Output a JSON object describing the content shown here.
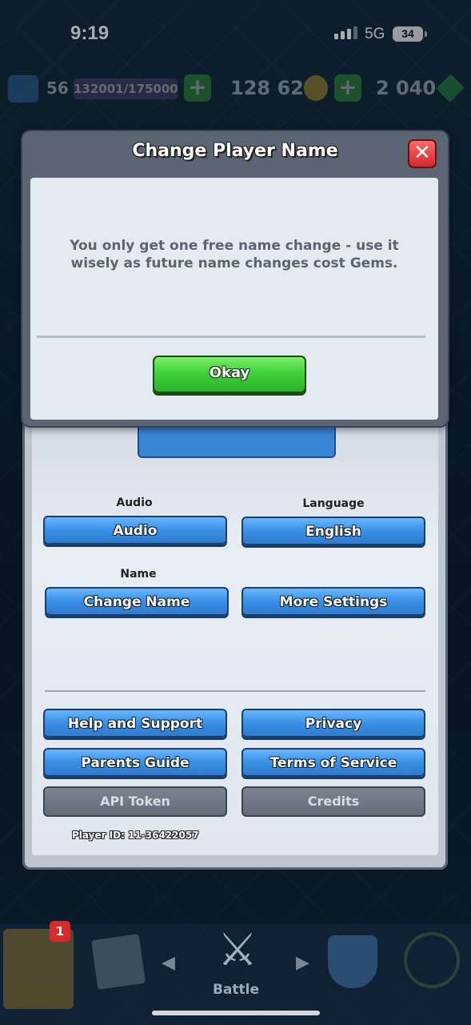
{
  "status_bar": {
    "time": "9:19",
    "network": "5G",
    "battery": "34"
  },
  "resources": {
    "level": "56",
    "xp": "132001/175000",
    "gold": "128 621",
    "gems": "2 040",
    "plus_label": "+"
  },
  "modal": {
    "title": "Change Player Name",
    "close_label": "✕",
    "message": "You only get one free name change - use it wisely as future name changes cost Gems.",
    "okay_label": "Okay"
  },
  "settings": {
    "audio_label": "Audio",
    "audio_button": "Audio",
    "language_label": "Language",
    "language_button": "English",
    "name_label": "Name",
    "change_name_button": "Change Name",
    "more_settings_button": "More Settings",
    "help_button": "Help and Support",
    "privacy_button": "Privacy",
    "parents_button": "Parents Guide",
    "terms_button": "Terms of Service",
    "api_button": "API Token",
    "credits_button": "Credits",
    "player_id": "Player ID: 11-36422057"
  },
  "nav": {
    "shop_badge": "1",
    "battle_label": "Battle",
    "arrow_left": "◀",
    "arrow_right": "▶",
    "battle_icon": "⚔"
  },
  "colors": {
    "primary_blue": "#3a8fe6",
    "okay_green": "#3fd13b",
    "close_red": "#d2282c",
    "grey_button": "#646d7a"
  }
}
